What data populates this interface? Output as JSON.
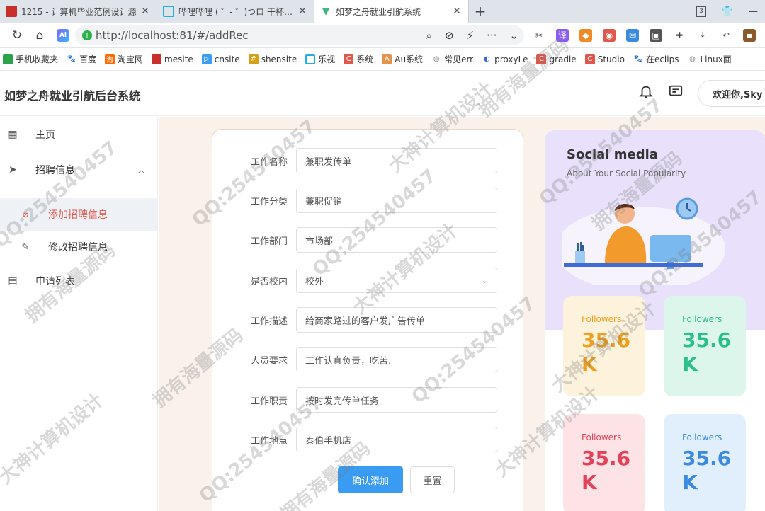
{
  "browser": {
    "tabs": [
      {
        "title": "1215 - 计算机毕业范例设计源",
        "icon": "red-flag-icon",
        "color": "#c9302c"
      },
      {
        "title": "哔哩哔哩 ( ゜- ゜)つロ 干杯~-b",
        "icon": "bilibili-icon",
        "color": "#23ade5"
      },
      {
        "title": "如梦之舟就业引航系统",
        "icon": "vue-icon",
        "color": "#41b883",
        "active": true
      }
    ],
    "tab_counter": "3",
    "url": "http://localhost:81/#/addRec",
    "url_host_bold": "localhost",
    "bookmarks": [
      {
        "label": "手机收藏夹",
        "icon": "phone-icon",
        "color": "#2aa34a"
      },
      {
        "label": "百度",
        "icon": "baidu-icon",
        "color": "#2932e1"
      },
      {
        "label": "淘宝网",
        "icon": "taobao-icon",
        "color": "#ff6a00"
      },
      {
        "label": "mesite",
        "icon": "flag-icon",
        "color": "#c9302c"
      },
      {
        "label": "cnsite",
        "icon": "play-icon",
        "color": "#3b9df2"
      },
      {
        "label": "shensite",
        "icon": "grid-icon",
        "color": "#d4a017"
      },
      {
        "label": "乐视",
        "icon": "tv-icon",
        "color": "#23ade5"
      },
      {
        "label": "系统",
        "icon": "c-icon",
        "color": "#e2574c"
      },
      {
        "label": "Au系统",
        "icon": "au-icon",
        "color": "#e2944c"
      },
      {
        "label": "常见err",
        "icon": "globe-icon",
        "color": "#888888"
      },
      {
        "label": "proxyLe",
        "icon": "proxy-icon",
        "color": "#3a6bd6"
      },
      {
        "label": "gradle",
        "icon": "c-icon",
        "color": "#e2574c"
      },
      {
        "label": "Studio",
        "icon": "c-icon",
        "color": "#e2574c"
      },
      {
        "label": "在eclips",
        "icon": "paw-icon",
        "color": "#2932e1"
      },
      {
        "label": "Linux面",
        "icon": "globe-icon",
        "color": "#888888"
      }
    ]
  },
  "app": {
    "title": "如梦之舟就业引航后台系统",
    "welcome": "欢迎你,Sky"
  },
  "sidebar": {
    "items": [
      {
        "label": "主页",
        "icon": "grid-icon"
      },
      {
        "label": "招聘信息",
        "icon": "send-icon"
      },
      {
        "label": "添加招聘信息",
        "icon": "paperclip-icon"
      },
      {
        "label": "修改招聘信息",
        "icon": "edit-icon"
      },
      {
        "label": "申请列表",
        "icon": "save-icon"
      }
    ]
  },
  "form": {
    "fields": [
      {
        "label": "工作名称",
        "value": "兼职发传单"
      },
      {
        "label": "工作分类",
        "value": "兼职促销"
      },
      {
        "label": "工作部门",
        "value": "市场部"
      },
      {
        "label": "是否校内",
        "value": "校外",
        "type": "select"
      },
      {
        "label": "工作描述",
        "value": "给商家路过的客户发广告传单"
      },
      {
        "label": "人员要求",
        "value": "工作认真负责，吃苦."
      },
      {
        "label": "工作职责",
        "value": "按时发完传单任务"
      },
      {
        "label": "工作地点",
        "value": "泰伯手机店"
      }
    ],
    "submit_label": "确认添加",
    "reset_label": "重置"
  },
  "social": {
    "title": "Social media",
    "subtitle": "About Your Social Popularity",
    "stats": [
      {
        "label": "Followers",
        "value": "35.6K",
        "bg": "#fdf3dc",
        "color": "#f0a020"
      },
      {
        "label": "Followers",
        "value": "35.6K",
        "bg": "#dcf6ec",
        "color": "#2bbf8a"
      },
      {
        "label": "Followers",
        "value": "35.6K",
        "bg": "#fde3e6",
        "color": "#e2435a"
      },
      {
        "label": "Followers",
        "value": "35.6K",
        "bg": "#e1eefc",
        "color": "#3a8be0"
      }
    ]
  },
  "watermarks": {
    "qq": "QQ:254540457",
    "text1": "大神计算机设计",
    "text2": "拥有海量源码"
  }
}
